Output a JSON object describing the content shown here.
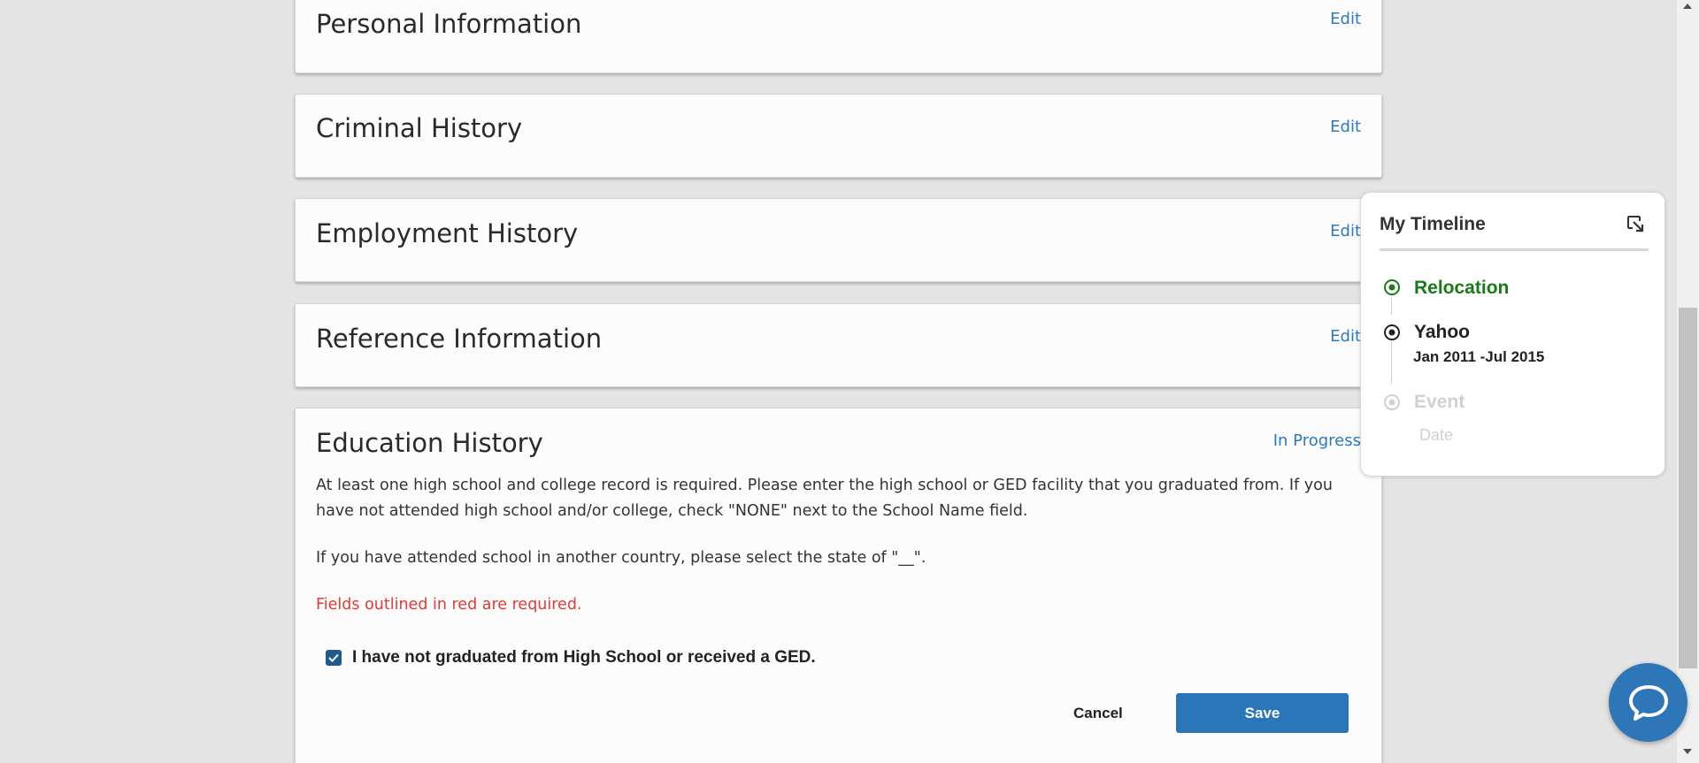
{
  "sections": [
    {
      "title": "Personal Information",
      "action": "Edit"
    },
    {
      "title": "Criminal History",
      "action": "Edit"
    },
    {
      "title": "Employment History",
      "action": "Edit"
    },
    {
      "title": "Reference Information",
      "action": "Edit"
    }
  ],
  "education": {
    "title": "Education History",
    "status": "In Progress",
    "instructions": "At least one high school and college record is required. Please enter the high school or GED facility that you graduated from. If you have not attended high school and/or college, check \"NONE\" next to the School Name field.",
    "foreign_note": "If you have attended school in another country, please select the state of \"__\".",
    "required_note": "Fields outlined in red are required.",
    "checkbox_label": "I have not graduated from High School or received a GED.",
    "checkbox_checked": true,
    "cancel_label": "Cancel",
    "save_label": "Save"
  },
  "timeline": {
    "title": "My Timeline",
    "items": [
      {
        "label": "Relocation",
        "date": "",
        "state": "current",
        "color": "#1a7a1a"
      },
      {
        "label": "Yahoo",
        "date": "Jan 2011 -Jul 2015",
        "state": "completed",
        "color": "#222222"
      },
      {
        "label": "Event",
        "date": "Date",
        "state": "placeholder",
        "color": "#d0d0d0"
      }
    ]
  },
  "colors": {
    "link": "#2b79bf",
    "primary_button": "#2b76b9",
    "required": "#e53935",
    "chat": "#2d76b8"
  },
  "icons": [
    "expand-icon",
    "check-icon",
    "chat-icon",
    "timeline-dot-icon"
  ]
}
